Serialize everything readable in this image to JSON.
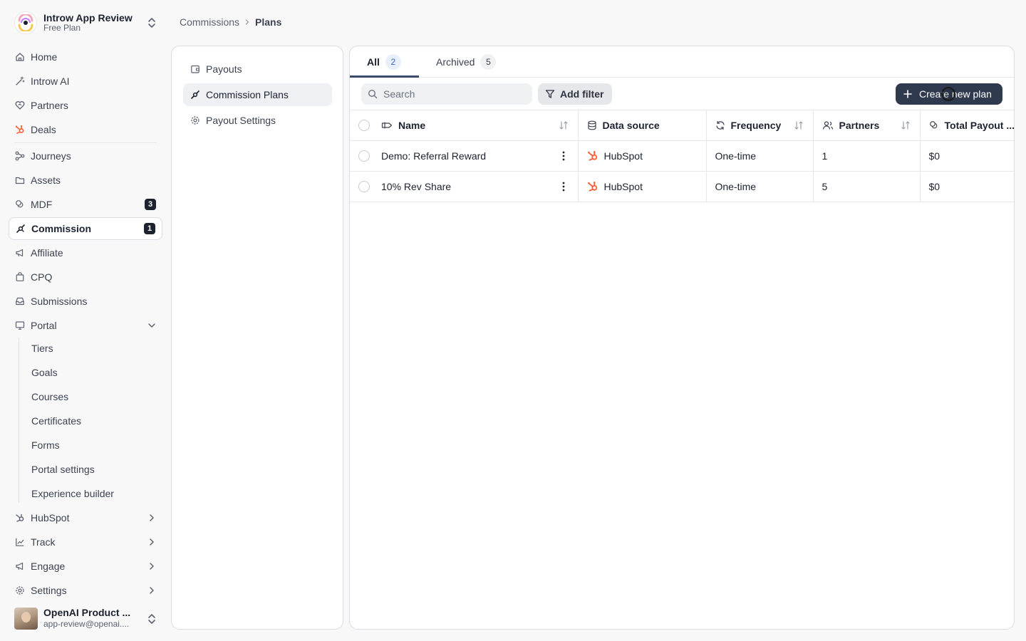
{
  "workspace": {
    "name": "Introw App Review",
    "plan": "Free Plan"
  },
  "nav": {
    "items": [
      {
        "label": "Home"
      },
      {
        "label": "Introw AI"
      },
      {
        "label": "Partners"
      },
      {
        "label": "Deals"
      },
      {
        "label": "Journeys"
      },
      {
        "label": "Assets"
      },
      {
        "label": "MDF",
        "badge": "3"
      },
      {
        "label": "Commission",
        "badge": "1"
      },
      {
        "label": "Affiliate"
      },
      {
        "label": "CPQ"
      },
      {
        "label": "Submissions"
      },
      {
        "label": "Portal"
      }
    ],
    "portal_sub": [
      "Tiers",
      "Goals",
      "Courses",
      "Certificates",
      "Forms",
      "Portal settings",
      "Experience builder"
    ],
    "groups": [
      {
        "label": "HubSpot"
      },
      {
        "label": "Track"
      },
      {
        "label": "Engage"
      },
      {
        "label": "Settings"
      }
    ]
  },
  "user": {
    "name": "OpenAI Product ...",
    "email": "app-review@openai...."
  },
  "breadcrumb": {
    "parent": "Commissions",
    "current": "Plans"
  },
  "submenu": {
    "items": [
      "Payouts",
      "Commission Plans",
      "Payout Settings"
    ]
  },
  "tabs": [
    {
      "label": "All",
      "count": "2"
    },
    {
      "label": "Archived",
      "count": "5"
    }
  ],
  "toolbar": {
    "search_placeholder": "Search",
    "filter_label": "Add filter",
    "create_label": "Create new plan"
  },
  "table": {
    "columns": [
      "Name",
      "Data source",
      "Frequency",
      "Partners",
      "Total Payout ..."
    ],
    "rows": [
      {
        "name": "Demo: Referral Reward",
        "source": "HubSpot",
        "frequency": "One-time",
        "partners": "1",
        "payout": "$0"
      },
      {
        "name": "10% Rev Share",
        "source": "HubSpot",
        "frequency": "One-time",
        "partners": "5",
        "payout": "$0"
      }
    ]
  },
  "colors": {
    "accent": "#2f3a4f",
    "hubspot": "#ff5c35",
    "badge_bg": "#1c2230",
    "tab_count_bg": "#e8f0fe"
  }
}
